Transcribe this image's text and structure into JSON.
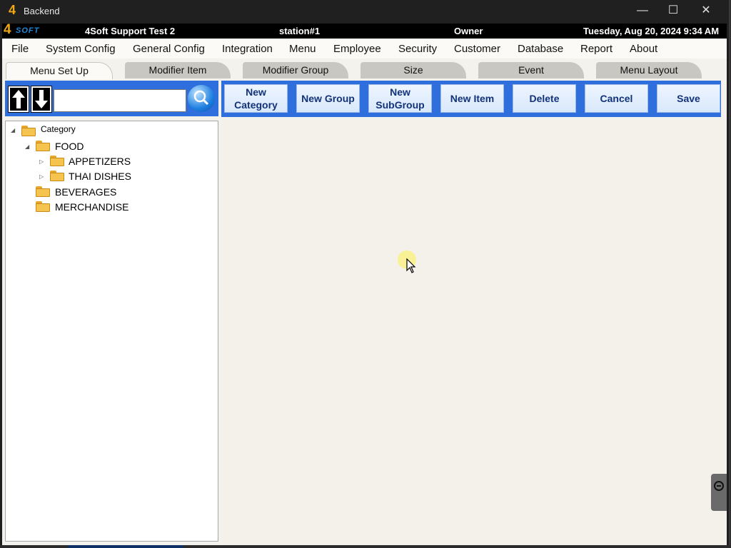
{
  "window": {
    "logo_glyph": "4",
    "title": "Backend",
    "minimize_glyph": "—",
    "maximize_glyph": "☐",
    "close_glyph": "✕"
  },
  "status": {
    "brand_four": "4",
    "brand_soft": "SOFT",
    "company": "4Soft Support Test 2",
    "station": "station#1",
    "user": "Owner",
    "datetime": "Tuesday, Aug 20, 2024 9:34 AM"
  },
  "menu": [
    "File",
    "System Config",
    "General Config",
    "Integration",
    "Menu",
    "Employee",
    "Security",
    "Customer",
    "Database",
    "Report",
    "About"
  ],
  "tabs": [
    {
      "label": "Menu Set Up",
      "active": true
    },
    {
      "label": "Modifier Item",
      "active": false
    },
    {
      "label": "Modifier Group",
      "active": false
    },
    {
      "label": "Size",
      "active": false
    },
    {
      "label": "Event",
      "active": false
    },
    {
      "label": "Menu Layout",
      "active": false
    }
  ],
  "search": {
    "value": "",
    "up_glyph": "🡑",
    "down_glyph": "🡓"
  },
  "tree": [
    {
      "label": "Category",
      "expander": "◢"
    },
    {
      "label": "FOOD",
      "expander": "◢"
    },
    {
      "label": "APPETIZERS",
      "expander": "▷"
    },
    {
      "label": "THAI DISHES",
      "expander": "▷"
    },
    {
      "label": "BEVERAGES",
      "expander": ""
    },
    {
      "label": "MERCHANDISE",
      "expander": ""
    }
  ],
  "toolbar": {
    "new_category_line1": "New",
    "new_category_line2": "Category",
    "new_group": "New Group",
    "new_subgroup_line1": "New",
    "new_subgroup_line2": "SubGroup",
    "new_item": "New Item",
    "delete": "Delete",
    "cancel": "Cancel",
    "save": "Save"
  },
  "colors": {
    "accent_blue": "#2f6fdd",
    "button_text": "#12327a",
    "brand_orange": "#f0a818"
  }
}
